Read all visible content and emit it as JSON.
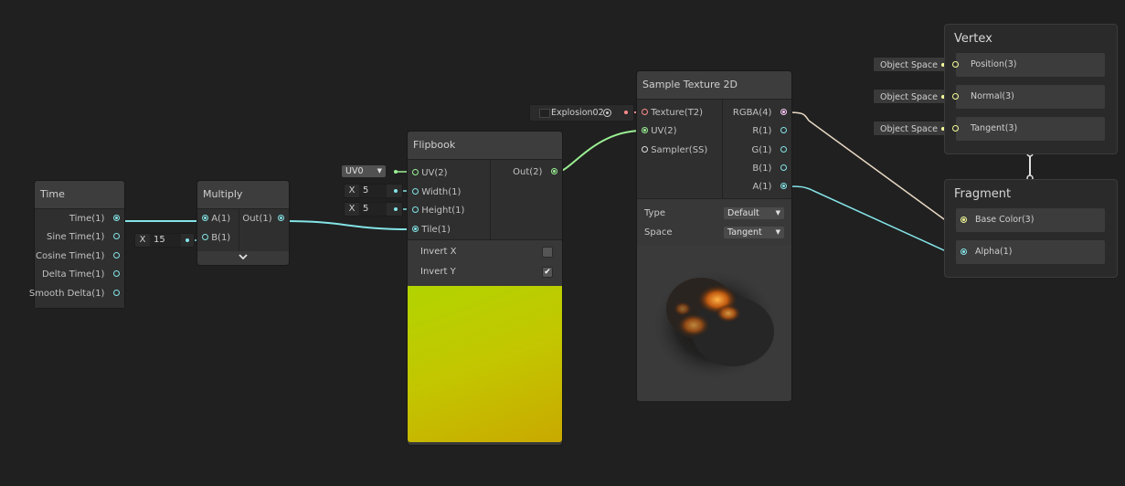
{
  "time_node": {
    "title": "Time",
    "outputs": [
      "Time(1)",
      "Sine Time(1)",
      "Cosine Time(1)",
      "Delta Time(1)",
      "Smooth Delta(1)"
    ]
  },
  "multiply_node": {
    "title": "Multiply",
    "inputs": [
      "A(1)",
      "B(1)"
    ],
    "output": "Out(1)",
    "b_field": {
      "label": "X",
      "value": "15"
    }
  },
  "flipbook_node": {
    "title": "Flipbook",
    "inputs": [
      "UV(2)",
      "Width(1)",
      "Height(1)",
      "Tile(1)"
    ],
    "output": "Out(2)",
    "uv_dropdown": "UV0",
    "width_field": {
      "label": "X",
      "value": "5"
    },
    "height_field": {
      "label": "X",
      "value": "5"
    },
    "toggles": [
      {
        "label": "Invert X",
        "checked": false
      },
      {
        "label": "Invert Y",
        "checked": true
      }
    ]
  },
  "sample_texture_node": {
    "title": "Sample Texture 2D",
    "texture_asset": "Explosion02",
    "inputs": [
      "Texture(T2)",
      "UV(2)",
      "Sampler(SS)"
    ],
    "outputs": [
      "RGBA(4)",
      "R(1)",
      "G(1)",
      "B(1)",
      "A(1)"
    ],
    "settings": [
      {
        "label": "Type",
        "value": "Default"
      },
      {
        "label": "Space",
        "value": "Tangent"
      }
    ]
  },
  "vertex_context": {
    "title": "Vertex",
    "blocks": [
      {
        "label": "Position(3)",
        "space": "Object Space"
      },
      {
        "label": "Normal(3)",
        "space": "Object Space"
      },
      {
        "label": "Tangent(3)",
        "space": "Object Space"
      }
    ]
  },
  "fragment_context": {
    "title": "Fragment",
    "blocks": [
      "Base Color(3)",
      "Alpha(1)"
    ]
  },
  "colors": {
    "float_port": "#84e4e7",
    "vector2_port": "#9aef92",
    "vector3_port": "#f6ff9a",
    "vector4_port": "#fbcbf4",
    "texture_port": "#ff8b8b",
    "background": "#202020"
  },
  "icons": {
    "expand": "chevron-down-icon",
    "texture_picker": "target-icon",
    "texture_thumb": "texture-thumbnail-icon"
  }
}
